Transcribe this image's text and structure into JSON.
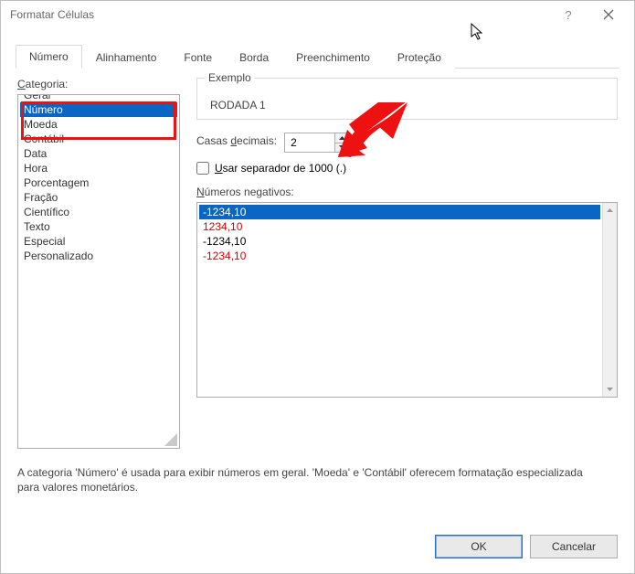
{
  "window": {
    "title": "Formatar Células"
  },
  "tabs": [
    "Número",
    "Alinhamento",
    "Fonte",
    "Borda",
    "Preenchimento",
    "Proteção"
  ],
  "category": {
    "label_html": "<span class='underline-key'>C</span>ategoria:",
    "items": [
      "Geral",
      "Número",
      "Moeda",
      "Contábil",
      "Data",
      "Hora",
      "Porcentagem",
      "Fração",
      "Científico",
      "Texto",
      "Especial",
      "Personalizado"
    ],
    "selected_index": 1
  },
  "example": {
    "legend": "Exemplo",
    "value": "RODADA 1"
  },
  "decimals": {
    "label_html": "Casas <span class='underline-key'>d</span>ecimais:",
    "value": "2"
  },
  "separator": {
    "label_html": "<span class='underline-key'>U</span>sar separador de 1000 (.)",
    "checked": false
  },
  "negatives": {
    "label_html": "<span class='underline-key'>N</span>úmeros negativos:",
    "items": [
      {
        "text": "-1234,10",
        "red": false
      },
      {
        "text": "1234,10",
        "red": true
      },
      {
        "text": "-1234,10",
        "red": false
      },
      {
        "text": "-1234,10",
        "red": true
      }
    ],
    "selected_index": 0
  },
  "description": "A categoria 'Número' é usada para exibir números em geral. 'Moeda' e 'Contábil' oferecem formatação especializada para valores monetários.",
  "buttons": {
    "ok": "OK",
    "cancel": "Cancelar"
  }
}
